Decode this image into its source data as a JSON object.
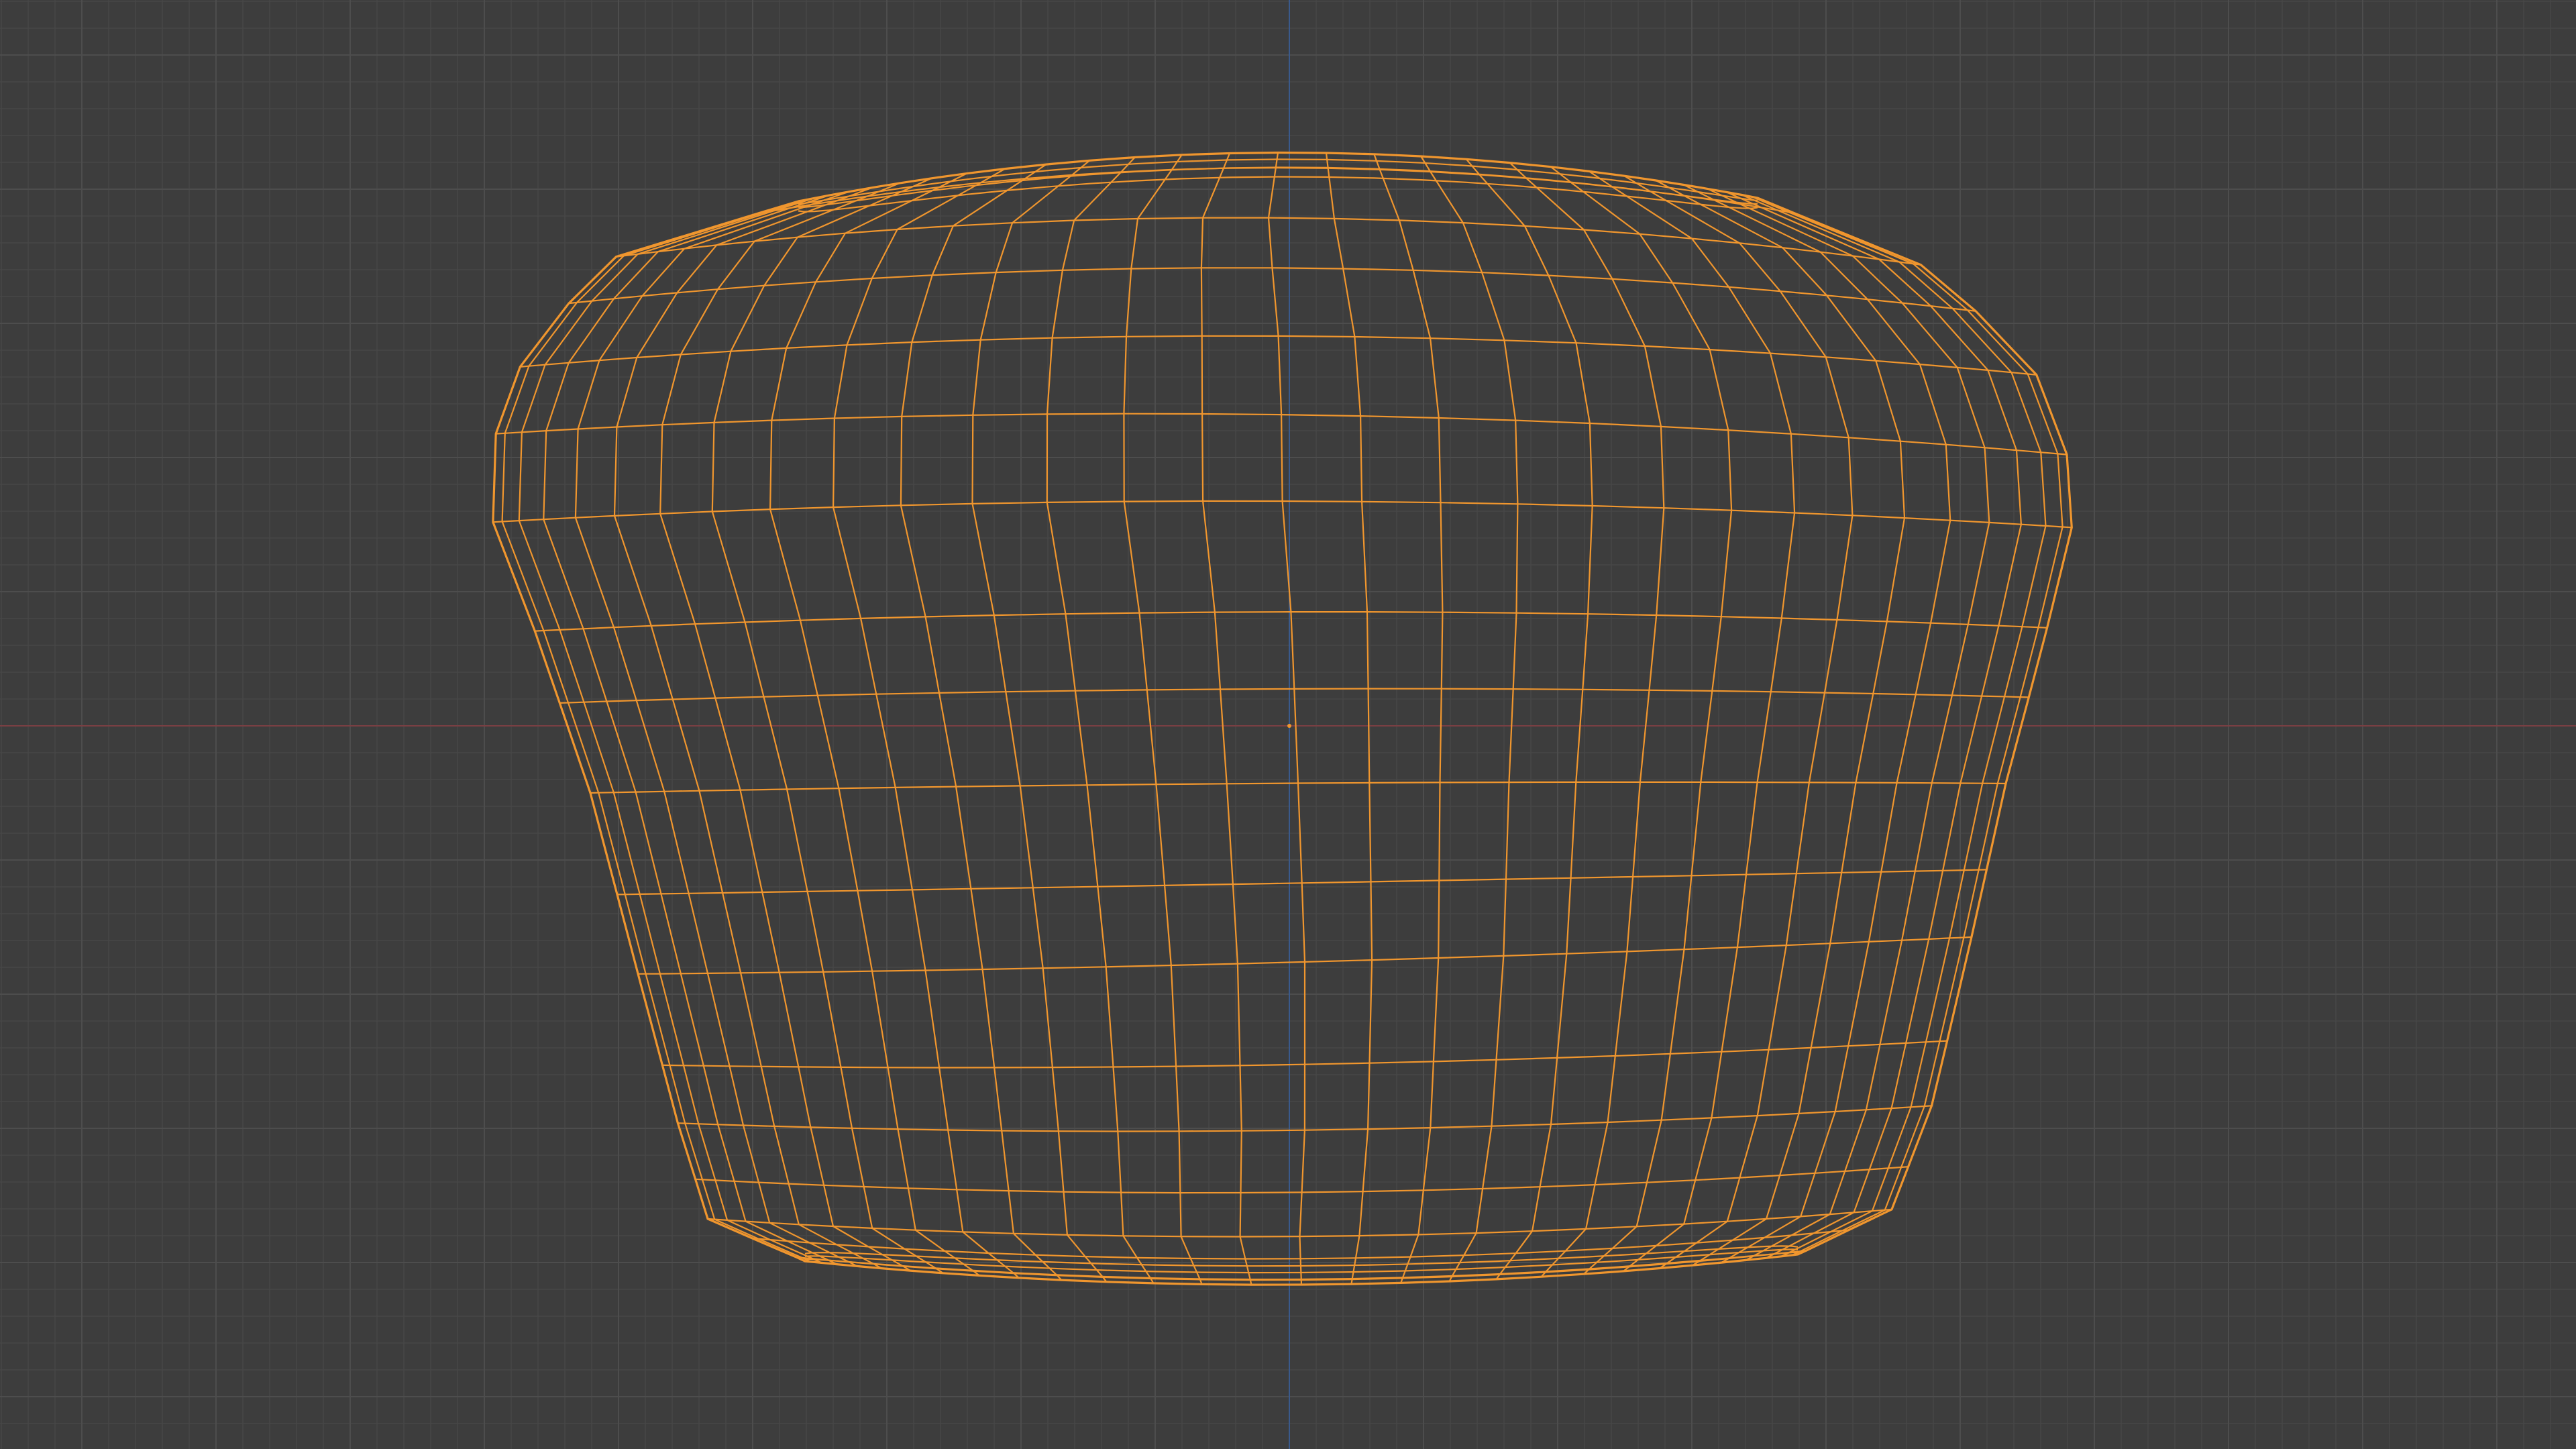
{
  "viewport": {
    "view": "front-orthographic",
    "mode": "wireframe",
    "background_color": "#3d3d3d",
    "grid": {
      "visible": true,
      "minor_color": "#474747",
      "major_color": "#4d4d4d"
    },
    "axes": {
      "x_axis_color": "#7a3f43",
      "z_axis_color": "#3a5a8c"
    }
  },
  "object": {
    "name": "",
    "type": "mesh",
    "selected": true,
    "wire_color": "#f0962e",
    "origin_color": "#f0962e",
    "rows": 19,
    "columns": 31
  }
}
